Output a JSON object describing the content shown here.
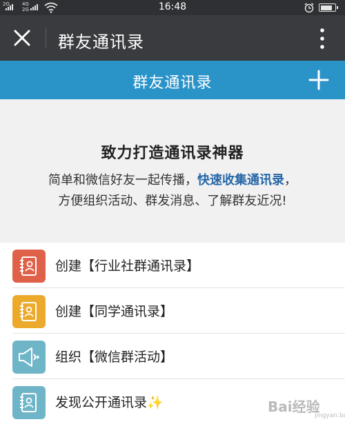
{
  "status_bar": {
    "time": "16:48",
    "sim1": "2G",
    "sim2": "4G",
    "sim2_b": "2G",
    "battery_level": 0.85
  },
  "wechat_bar": {
    "title": "群友通讯录",
    "close_icon": "close-icon",
    "more_icon": "more-vertical-icon"
  },
  "app_bar": {
    "title": "群友通讯录",
    "add_icon": "plus-icon"
  },
  "hero": {
    "title": "致力打造通讯录神器",
    "line1_pre": "简单和微信好友一起传播，",
    "line1_highlight": "快速收集通讯录",
    "line1_post": "，",
    "line2": "方便组织活动、群发消息、了解群友近况!"
  },
  "menu": [
    {
      "label": "创建【行业社群通讯录】",
      "icon": "contact-book-icon",
      "color": "#e0614a"
    },
    {
      "label": "创建【同学通讯录】",
      "icon": "contact-book-icon",
      "color": "#ecaa2c"
    },
    {
      "label": "组织【微信群活动】",
      "icon": "megaphone-icon",
      "color": "#6fb5c8"
    },
    {
      "label": "发现公开通讯录",
      "sparkle": "✨",
      "icon": "contact-book-icon",
      "color": "#6fb5c8"
    }
  ],
  "watermark": {
    "text": "Bai经验",
    "sub": "jingyan.baidu.com"
  }
}
